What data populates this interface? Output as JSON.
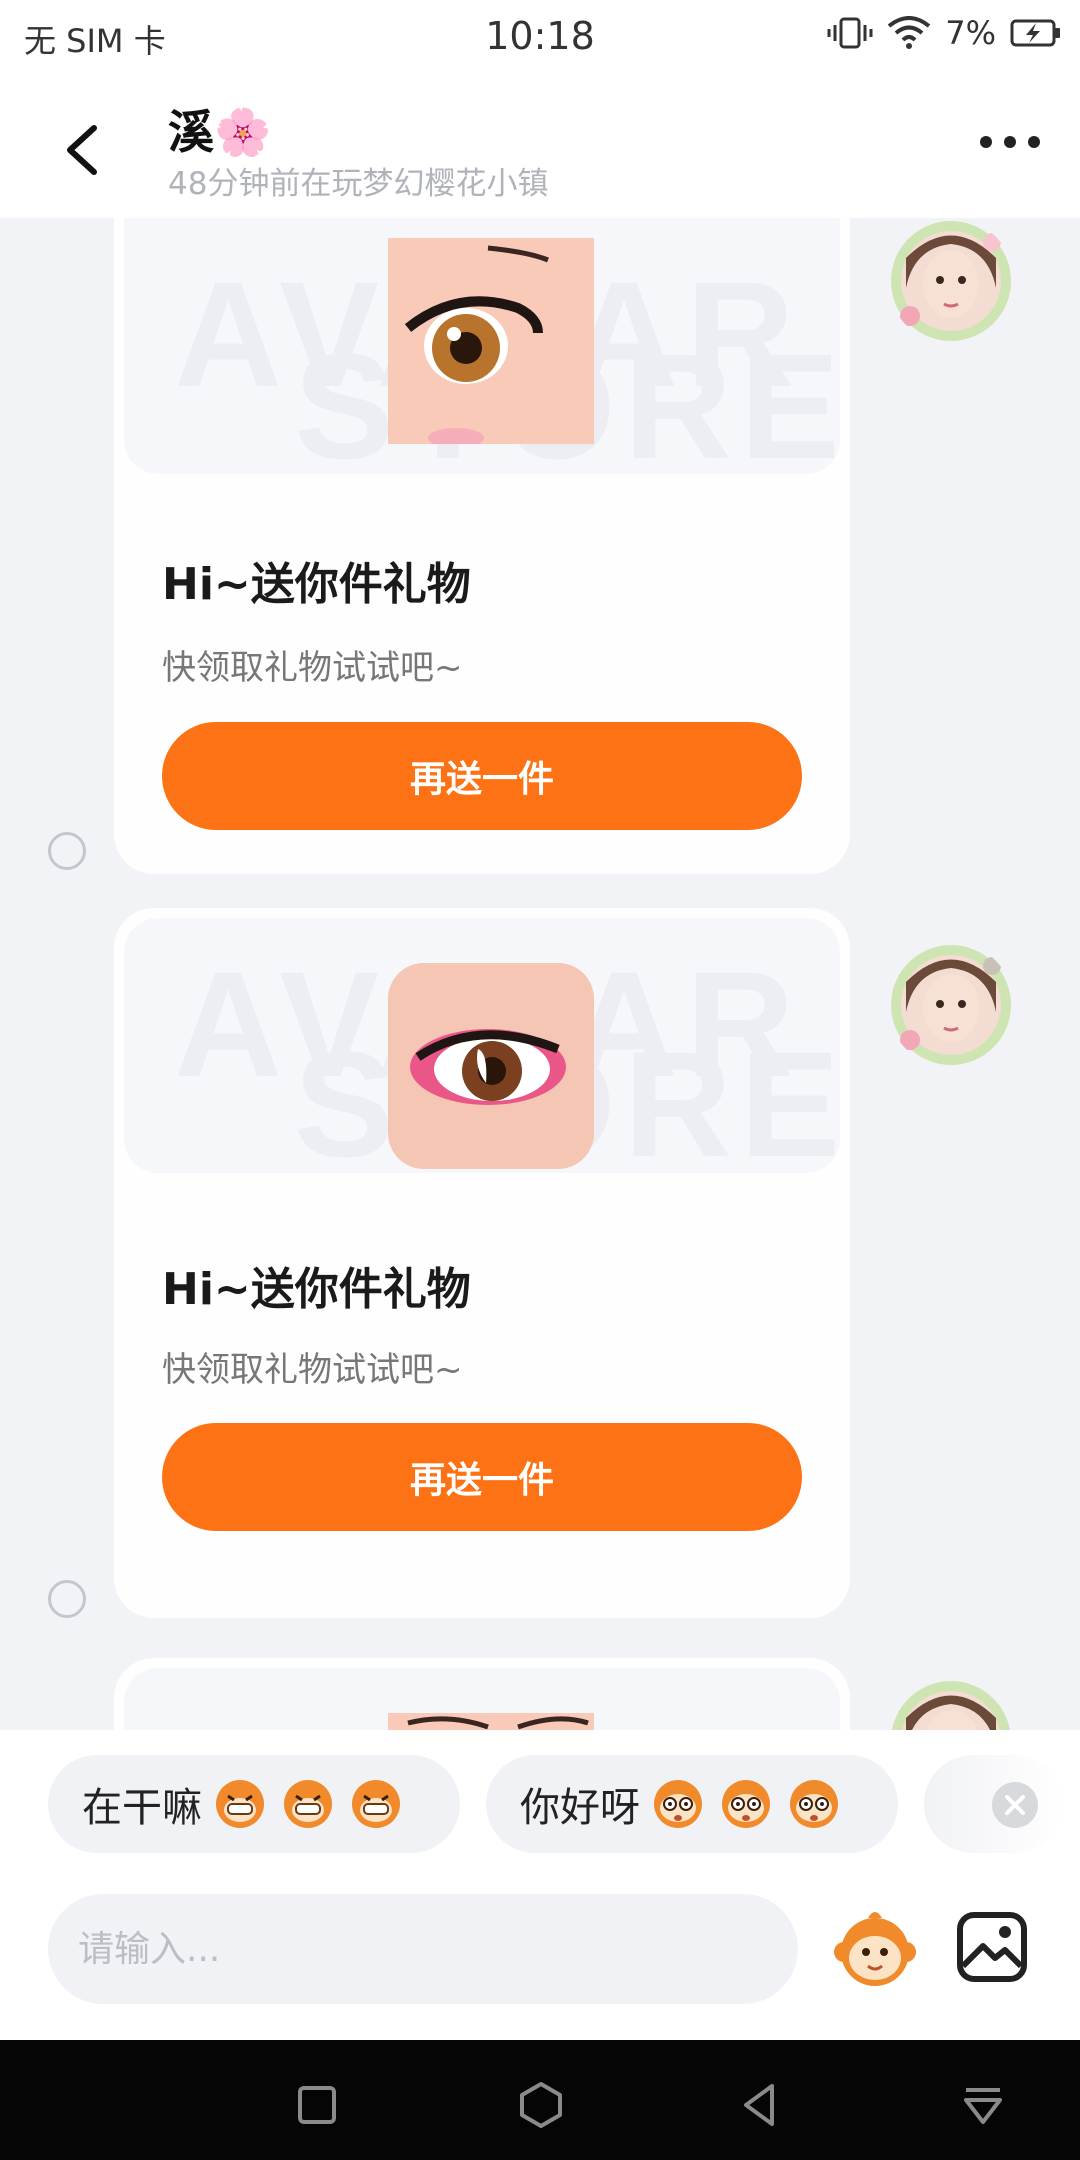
{
  "status_bar": {
    "carrier": "无 SIM 卡",
    "time": "10:18",
    "battery": "7%",
    "icons": [
      "vibrate-icon",
      "wifi-icon",
      "battery-charging-icon"
    ]
  },
  "header": {
    "title": "溪🌸",
    "subtitle": "48分钟前在玩梦幻樱花小镇",
    "back_icon": "back-arrow-icon",
    "more_icon": "more-dots-icon"
  },
  "messages": [
    {
      "title": "Hi~送你件礼物",
      "description": "快领取礼物试试吧~",
      "button": "再送一件",
      "watermark_lines": [
        "AVATAR",
        "STORE"
      ],
      "gift_icon": "eye-gift-icon"
    },
    {
      "title": "Hi~送你件礼物",
      "description": "快领取礼物试试吧~",
      "button": "再送一件",
      "watermark_lines": [
        "AVATAR",
        "STORE"
      ],
      "gift_icon": "eye-gift-icon"
    }
  ],
  "quick_replies": [
    {
      "label": "在干嘛",
      "emoji_icon": "grinning-monkey-icon"
    },
    {
      "label": "你好呀",
      "emoji_icon": "wide-eyed-monkey-icon"
    }
  ],
  "input": {
    "placeholder": "请输入..."
  },
  "colors": {
    "accent": "#fc7214",
    "background": "#f2f3f7",
    "card": "#fefefe"
  }
}
